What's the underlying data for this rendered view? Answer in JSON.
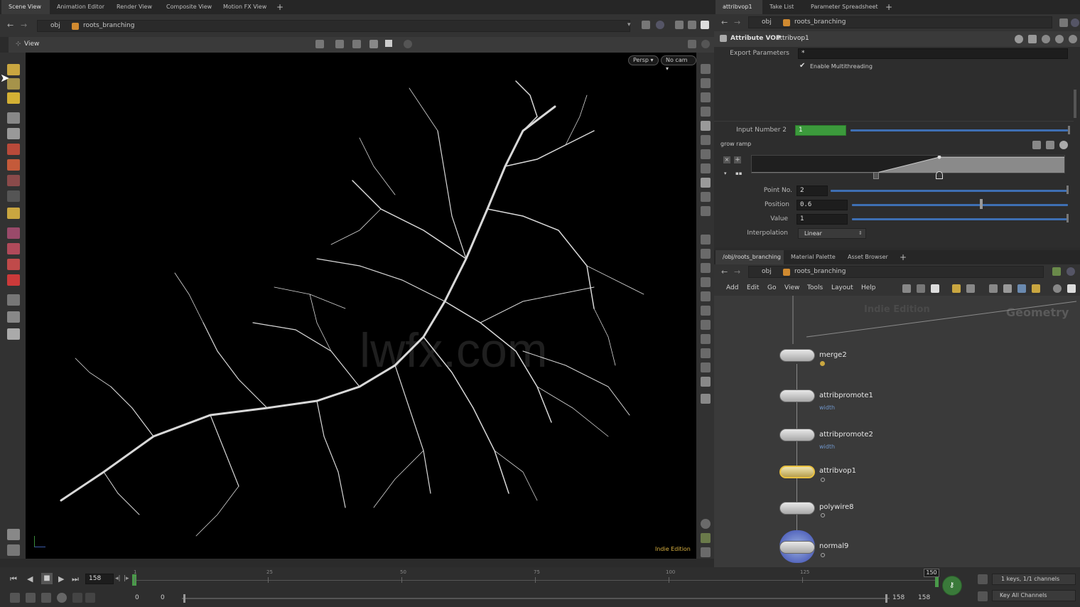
{
  "left_tabs": [
    "Scene View",
    "Animation Editor",
    "Render View",
    "Composite View",
    "Motion FX View"
  ],
  "right_tabs": [
    "attribvop1",
    "Take List",
    "Parameter Spreadsheet"
  ],
  "network_tabs": [
    "/obj/roots_branching",
    "Material Palette",
    "Asset Browser"
  ],
  "path": {
    "root": "obj",
    "node": "roots_branching"
  },
  "viewport": {
    "title": "View",
    "persp_label": "Persp",
    "cam_label": "No cam",
    "watermark": "lwfx.com",
    "edition": "Indie Edition"
  },
  "params": {
    "node_type": "Attribute VOP",
    "node_name": "attribvop1",
    "export_label": "Export Parameters",
    "export_value": "*",
    "multithread_label": "Enable Multithreading",
    "input_label": "Input Number 2",
    "input_value": "1",
    "ramp_label": "grow ramp",
    "point_label": "Point No.",
    "point_value": "2",
    "position_label": "Position",
    "position_value": "0.6",
    "value_label": "Value",
    "value_value": "1",
    "interp_label": "Interpolation",
    "interp_value": "Linear"
  },
  "network": {
    "menu": [
      "Add",
      "Edit",
      "Go",
      "View",
      "Tools",
      "Layout",
      "Help"
    ],
    "edition_watermark": "Indie Edition",
    "context_label": "Geometry",
    "nodes": [
      {
        "name": "merge2",
        "sub": ""
      },
      {
        "name": "attribpromote1",
        "sub": "width"
      },
      {
        "name": "attribpromote2",
        "sub": "width"
      },
      {
        "name": "attribvop1",
        "sub": ""
      },
      {
        "name": "polywire8",
        "sub": ""
      },
      {
        "name": "normal9",
        "sub": ""
      }
    ]
  },
  "timeline": {
    "current_frame": "158",
    "ticks": [
      "1",
      "25",
      "50",
      "75",
      "100",
      "125"
    ],
    "end_marker": "150",
    "range_start": "0",
    "range_start2": "0",
    "range_end": "158",
    "range_end2": "158",
    "keys_label": "1 keys, 1/1 channels",
    "key_all_label": "Key All Channels"
  },
  "colors": {
    "accent_green": "#3c9a3c",
    "slider_blue": "#3e6fb3",
    "node_selected": "#e8c040"
  }
}
